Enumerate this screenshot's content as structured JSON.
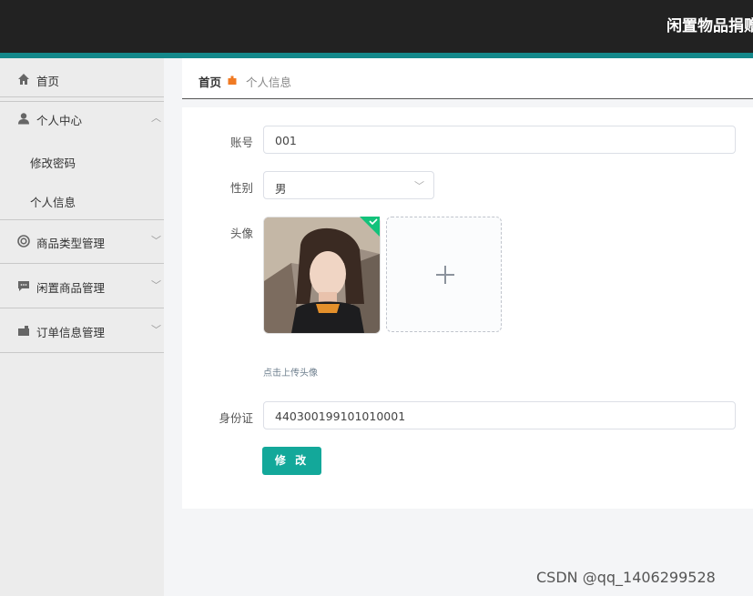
{
  "header": {
    "title": "闲置物品捐赠"
  },
  "sidebar": {
    "items": [
      {
        "label": "首页",
        "icon": "home-icon"
      },
      {
        "label": "个人中心",
        "icon": "user-icon",
        "expanded": true,
        "children": [
          {
            "label": "修改密码"
          },
          {
            "label": "个人信息"
          }
        ]
      },
      {
        "label": "商品类型管理",
        "icon": "lifebuoy-icon"
      },
      {
        "label": "闲置商品管理",
        "icon": "chat-icon"
      },
      {
        "label": "订单信息管理",
        "icon": "briefcase-icon"
      }
    ]
  },
  "breadcrumb": {
    "home": "首页",
    "current": "个人信息"
  },
  "form": {
    "account": {
      "label": "账号",
      "value": "001"
    },
    "gender": {
      "label": "性别",
      "value": "男"
    },
    "avatar": {
      "label": "头像",
      "hint": "点击上传头像"
    },
    "id_card": {
      "label": "身份证",
      "value": "440300199101010001"
    },
    "submit_label": "修 改"
  },
  "watermark": "CSDN @qq_1406299528",
  "colors": {
    "accent": "#13a89a",
    "topbar": "#222222",
    "topbar_border": "#14888a"
  }
}
